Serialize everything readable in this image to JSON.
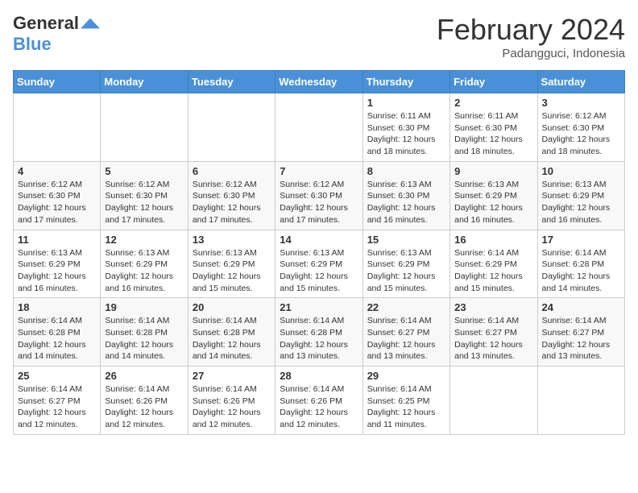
{
  "header": {
    "logo_general": "General",
    "logo_blue": "Blue",
    "month_title": "February 2024",
    "subtitle": "Padangguci, Indonesia"
  },
  "days_of_week": [
    "Sunday",
    "Monday",
    "Tuesday",
    "Wednesday",
    "Thursday",
    "Friday",
    "Saturday"
  ],
  "weeks": [
    [
      {
        "day": "",
        "info": ""
      },
      {
        "day": "",
        "info": ""
      },
      {
        "day": "",
        "info": ""
      },
      {
        "day": "",
        "info": ""
      },
      {
        "day": "1",
        "info": "Sunrise: 6:11 AM\nSunset: 6:30 PM\nDaylight: 12 hours and 18 minutes."
      },
      {
        "day": "2",
        "info": "Sunrise: 6:11 AM\nSunset: 6:30 PM\nDaylight: 12 hours and 18 minutes."
      },
      {
        "day": "3",
        "info": "Sunrise: 6:12 AM\nSunset: 6:30 PM\nDaylight: 12 hours and 18 minutes."
      }
    ],
    [
      {
        "day": "4",
        "info": "Sunrise: 6:12 AM\nSunset: 6:30 PM\nDaylight: 12 hours and 17 minutes."
      },
      {
        "day": "5",
        "info": "Sunrise: 6:12 AM\nSunset: 6:30 PM\nDaylight: 12 hours and 17 minutes."
      },
      {
        "day": "6",
        "info": "Sunrise: 6:12 AM\nSunset: 6:30 PM\nDaylight: 12 hours and 17 minutes."
      },
      {
        "day": "7",
        "info": "Sunrise: 6:12 AM\nSunset: 6:30 PM\nDaylight: 12 hours and 17 minutes."
      },
      {
        "day": "8",
        "info": "Sunrise: 6:13 AM\nSunset: 6:30 PM\nDaylight: 12 hours and 16 minutes."
      },
      {
        "day": "9",
        "info": "Sunrise: 6:13 AM\nSunset: 6:29 PM\nDaylight: 12 hours and 16 minutes."
      },
      {
        "day": "10",
        "info": "Sunrise: 6:13 AM\nSunset: 6:29 PM\nDaylight: 12 hours and 16 minutes."
      }
    ],
    [
      {
        "day": "11",
        "info": "Sunrise: 6:13 AM\nSunset: 6:29 PM\nDaylight: 12 hours and 16 minutes."
      },
      {
        "day": "12",
        "info": "Sunrise: 6:13 AM\nSunset: 6:29 PM\nDaylight: 12 hours and 16 minutes."
      },
      {
        "day": "13",
        "info": "Sunrise: 6:13 AM\nSunset: 6:29 PM\nDaylight: 12 hours and 15 minutes."
      },
      {
        "day": "14",
        "info": "Sunrise: 6:13 AM\nSunset: 6:29 PM\nDaylight: 12 hours and 15 minutes."
      },
      {
        "day": "15",
        "info": "Sunrise: 6:13 AM\nSunset: 6:29 PM\nDaylight: 12 hours and 15 minutes."
      },
      {
        "day": "16",
        "info": "Sunrise: 6:14 AM\nSunset: 6:29 PM\nDaylight: 12 hours and 15 minutes."
      },
      {
        "day": "17",
        "info": "Sunrise: 6:14 AM\nSunset: 6:28 PM\nDaylight: 12 hours and 14 minutes."
      }
    ],
    [
      {
        "day": "18",
        "info": "Sunrise: 6:14 AM\nSunset: 6:28 PM\nDaylight: 12 hours and 14 minutes."
      },
      {
        "day": "19",
        "info": "Sunrise: 6:14 AM\nSunset: 6:28 PM\nDaylight: 12 hours and 14 minutes."
      },
      {
        "day": "20",
        "info": "Sunrise: 6:14 AM\nSunset: 6:28 PM\nDaylight: 12 hours and 14 minutes."
      },
      {
        "day": "21",
        "info": "Sunrise: 6:14 AM\nSunset: 6:28 PM\nDaylight: 12 hours and 13 minutes."
      },
      {
        "day": "22",
        "info": "Sunrise: 6:14 AM\nSunset: 6:27 PM\nDaylight: 12 hours and 13 minutes."
      },
      {
        "day": "23",
        "info": "Sunrise: 6:14 AM\nSunset: 6:27 PM\nDaylight: 12 hours and 13 minutes."
      },
      {
        "day": "24",
        "info": "Sunrise: 6:14 AM\nSunset: 6:27 PM\nDaylight: 12 hours and 13 minutes."
      }
    ],
    [
      {
        "day": "25",
        "info": "Sunrise: 6:14 AM\nSunset: 6:27 PM\nDaylight: 12 hours and 12 minutes."
      },
      {
        "day": "26",
        "info": "Sunrise: 6:14 AM\nSunset: 6:26 PM\nDaylight: 12 hours and 12 minutes."
      },
      {
        "day": "27",
        "info": "Sunrise: 6:14 AM\nSunset: 6:26 PM\nDaylight: 12 hours and 12 minutes."
      },
      {
        "day": "28",
        "info": "Sunrise: 6:14 AM\nSunset: 6:26 PM\nDaylight: 12 hours and 12 minutes."
      },
      {
        "day": "29",
        "info": "Sunrise: 6:14 AM\nSunset: 6:25 PM\nDaylight: 12 hours and 11 minutes."
      },
      {
        "day": "",
        "info": ""
      },
      {
        "day": "",
        "info": ""
      }
    ]
  ]
}
